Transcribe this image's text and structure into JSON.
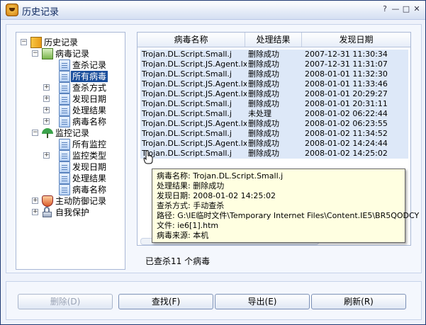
{
  "window": {
    "title": "历史记录",
    "buttons": {
      "help": "?",
      "minimize": "—",
      "maximize": "□",
      "close": "✕"
    }
  },
  "tree": {
    "root": "历史记录",
    "virus_log": "病毒记录",
    "virus_children": [
      "查杀记录",
      "所有病毒",
      "查杀方式",
      "发现日期",
      "处理结果",
      "病毒名称"
    ],
    "monitor_log": "监控记录",
    "monitor_children": [
      "所有监控",
      "监控类型",
      "发现日期",
      "处理结果",
      "病毒名称"
    ],
    "defense_log": "主动防御记录",
    "self_protect": "自我保护"
  },
  "table": {
    "columns": [
      "病毒名称",
      "处理结果",
      "发现日期"
    ],
    "rows": [
      [
        "Trojan.DL.Script.Small.j",
        "删除成功",
        "2007-12-31 11:30:34"
      ],
      [
        "Trojan.DL.Script.JS.Agent.lxo",
        "删除成功",
        "2007-12-31 11:31:07"
      ],
      [
        "Trojan.DL.Script.Small.j",
        "删除成功",
        "2008-01-01 11:32:30"
      ],
      [
        "Trojan.DL.Script.JS.Agent.lxo",
        "删除成功",
        "2008-01-01 11:33:46"
      ],
      [
        "Trojan.DL.Script.JS.Agent.lxo",
        "删除成功",
        "2008-01-01 20:29:27"
      ],
      [
        "Trojan.DL.Script.Small.j",
        "删除成功",
        "2008-01-01 20:31:11"
      ],
      [
        "Trojan.DL.Script.Small.j",
        "未处理",
        "2008-01-02 06:22:44"
      ],
      [
        "Trojan.DL.Script.JS.Agent.lxo",
        "删除成功",
        "2008-01-02 06:23:55"
      ],
      [
        "Trojan.DL.Script.Small.j",
        "删除成功",
        "2008-01-02 11:34:52"
      ],
      [
        "Trojan.DL.Script.JS.Agent.lxo",
        "删除成功",
        "2008-01-02 14:24:44"
      ],
      [
        "Trojan.DL.Script.Small.j",
        "删除成功",
        "2008-01-02 14:25:02"
      ]
    ]
  },
  "tooltip": {
    "lines": [
      "病毒名称: Trojan.DL.Script.Small.j",
      "处理结果: 删除成功",
      "发现日期: 2008-01-02 14:25:02",
      "查杀方式: 手动查杀",
      "路径: G:\\IE临时文件\\Temporary Internet Files\\Content.IE5\\BR5QODCY",
      "文件: ie6[1].htm",
      "病毒来源: 本机"
    ]
  },
  "status": "已查杀11 个病毒",
  "footer": {
    "delete": "删除(D)",
    "find": "查找(F)",
    "export": "导出(E)",
    "refresh": "刷新(R)"
  },
  "colors": {
    "selection": "#1b4f9c",
    "row_bg": "#dde8f8",
    "tooltip_bg": "#ffffe1"
  }
}
